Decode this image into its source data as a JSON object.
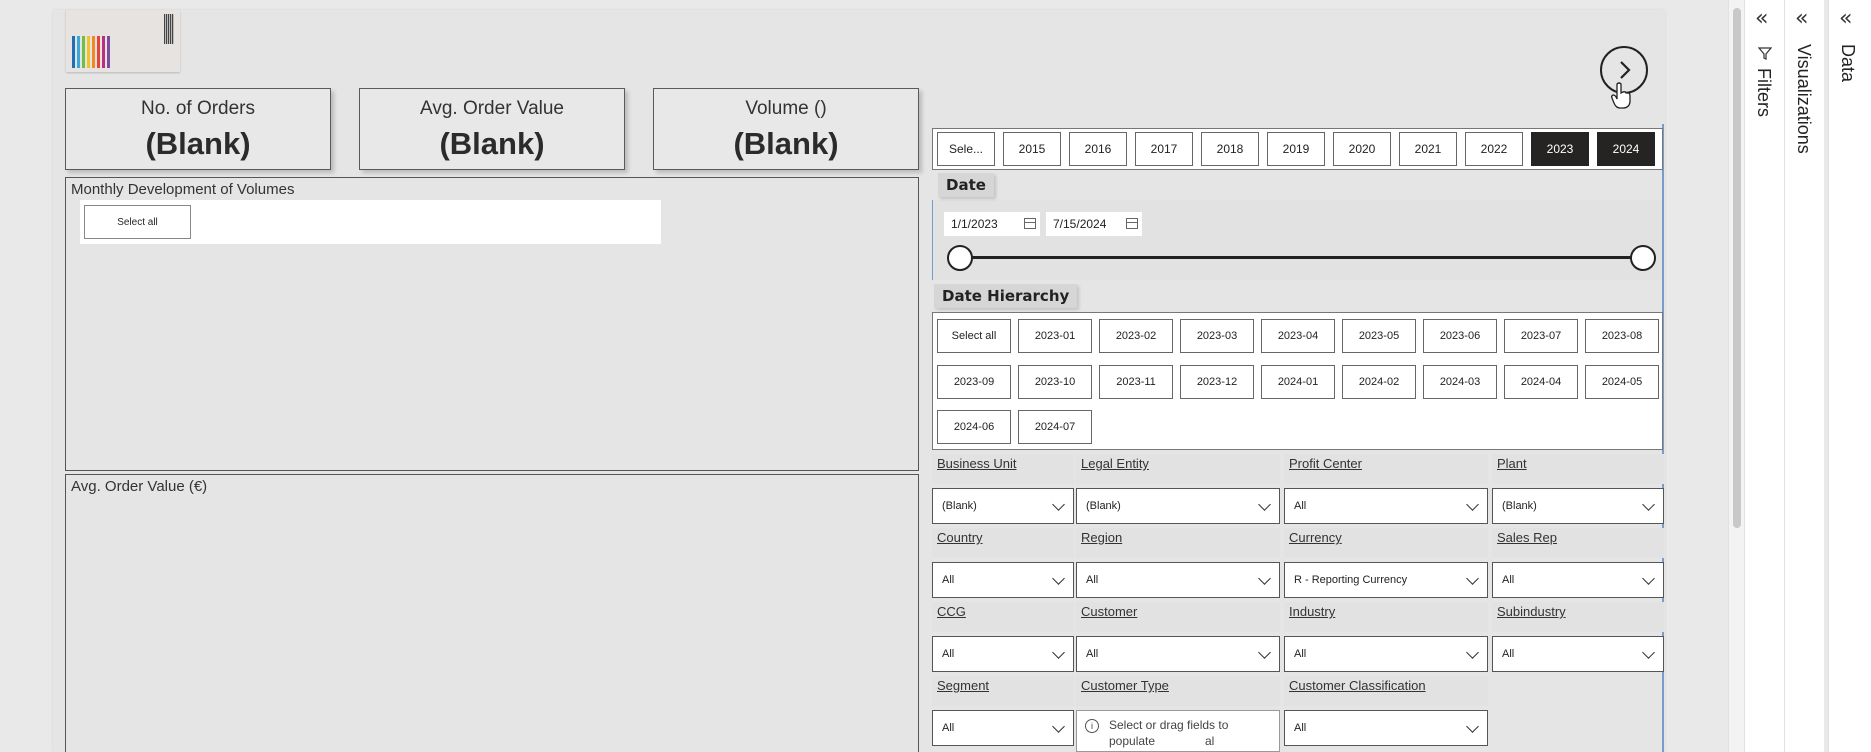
{
  "kpis": [
    {
      "title": "No. of Orders",
      "value": "(Blank)"
    },
    {
      "title": "Avg. Order Value",
      "value": "(Blank)"
    },
    {
      "title": "Volume ()",
      "value": "(Blank)"
    }
  ],
  "visuals": {
    "monthly_title": "Monthly Development of Volumes",
    "monthly_select_all": "Select all",
    "aov_title": "Avg. Order Value (€)"
  },
  "years": [
    "Sele...",
    "2015",
    "2016",
    "2017",
    "2018",
    "2019",
    "2020",
    "2021",
    "2022",
    "2023",
    "2024"
  ],
  "selected_years": [
    "2023",
    "2024"
  ],
  "date": {
    "title": "Date",
    "start": "1/1/2023",
    "end": "7/15/2024"
  },
  "date_hierarchy": {
    "title": "Date Hierarchy",
    "items": [
      "Select all",
      "2023-01",
      "2023-02",
      "2023-03",
      "2023-04",
      "2023-05",
      "2023-06",
      "2023-07",
      "2023-08",
      "2023-09",
      "2023-10",
      "2023-11",
      "2023-12",
      "2024-01",
      "2024-02",
      "2024-03",
      "2024-04",
      "2024-05",
      "2024-06",
      "2024-07"
    ]
  },
  "filters": [
    {
      "label": "Business Unit",
      "value": "(Blank)"
    },
    {
      "label": "Legal Entity",
      "value": "(Blank)"
    },
    {
      "label": "Profit Center",
      "value": "All"
    },
    {
      "label": "Plant",
      "value": "(Blank)"
    },
    {
      "label": "Country",
      "value": "All"
    },
    {
      "label": "Region",
      "value": "All"
    },
    {
      "label": "Currency",
      "value": "R - Reporting Currency"
    },
    {
      "label": "Sales Rep",
      "value": "All"
    },
    {
      "label": "CCG",
      "value": "All"
    },
    {
      "label": "Customer",
      "value": "All"
    },
    {
      "label": "Industry",
      "value": "All"
    },
    {
      "label": "Subindustry",
      "value": "All"
    },
    {
      "label": "Segment",
      "value": "All"
    },
    {
      "label": "Customer Type",
      "value": ""
    },
    {
      "label": "Customer Classification",
      "value": "All"
    }
  ],
  "customer_type_placeholder": "Select or drag fields to populate",
  "customer_type_fragment": "al",
  "panes": {
    "filters": "Filters",
    "visualizations": "Visualizations",
    "data": "Data"
  },
  "icons": {
    "nav": "chevron-right-icon",
    "collapse": "double-chevron-left-icon",
    "filter": "funnel-icon",
    "calendar": "calendar-icon",
    "info": "info-icon"
  },
  "colors": {
    "selected_year_bg": "#252423",
    "accent_frame": "#7a9cc8"
  }
}
